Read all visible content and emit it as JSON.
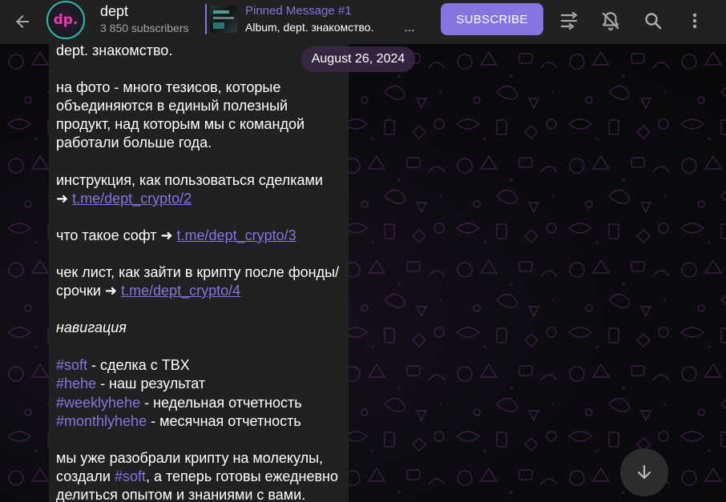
{
  "header": {
    "back_icon": "arrow-left-icon",
    "avatar_text": "dp.",
    "channel_title": "dept",
    "subscribers": "3 850 subscribers",
    "pinned": {
      "label": "Pinned Message #1",
      "text": "Album, dept. знакомство.",
      "ellipsis": "…"
    },
    "subscribe_label": "SUBSCRIBE",
    "icons": [
      "live-stream-icon",
      "notifications-off-icon",
      "search-icon",
      "more-vertical-icon"
    ]
  },
  "chat": {
    "date": "August 26, 2024",
    "message": {
      "line1": "dept. знакомство.",
      "p1_l1": "на фото - много тезисов, которые",
      "p1_l2": "объединяются в единый полезный",
      "p1_l3": "продукт, над которым мы с командой",
      "p1_l4": "работали больше года.",
      "p2_l1": "инструкция, как пользоваться сделками",
      "p2_arrow": "➜ ",
      "p2_link": "t.me/dept_crypto/2",
      "p3_text": "что такое софт ➜ ",
      "p3_link": "t.me/dept_crypto/3",
      "p4_l1": "чек лист, как зайти в крипту после фонды/",
      "p4_l2": "срочки ➜ ",
      "p4_link": "t.me/dept_crypto/4",
      "nav": "навигация",
      "tags": [
        {
          "tag": "#soft",
          "text": " - сделка с TBX"
        },
        {
          "tag": "#hehe",
          "text": " - наш результат"
        },
        {
          "tag": "#weeklyhehe",
          "text": " - недельная отчетность"
        },
        {
          "tag": "#monthlyhehe",
          "text": " - месячная отчетность"
        }
      ],
      "p6_l1": "мы уже разобрали крипту на молекулы,",
      "p6_l2_pre": "создали ",
      "p6_l2_tag": "#soft",
      "p6_l2_post": ", а теперь готовы ежедневно",
      "p6_l3": "делиться опытом и знаниями с вами."
    },
    "scroll_down_icon": "arrow-down-icon"
  },
  "colors": {
    "accent": "#8774e1",
    "header_bg": "#212121",
    "bubble_bg": "#212121"
  }
}
